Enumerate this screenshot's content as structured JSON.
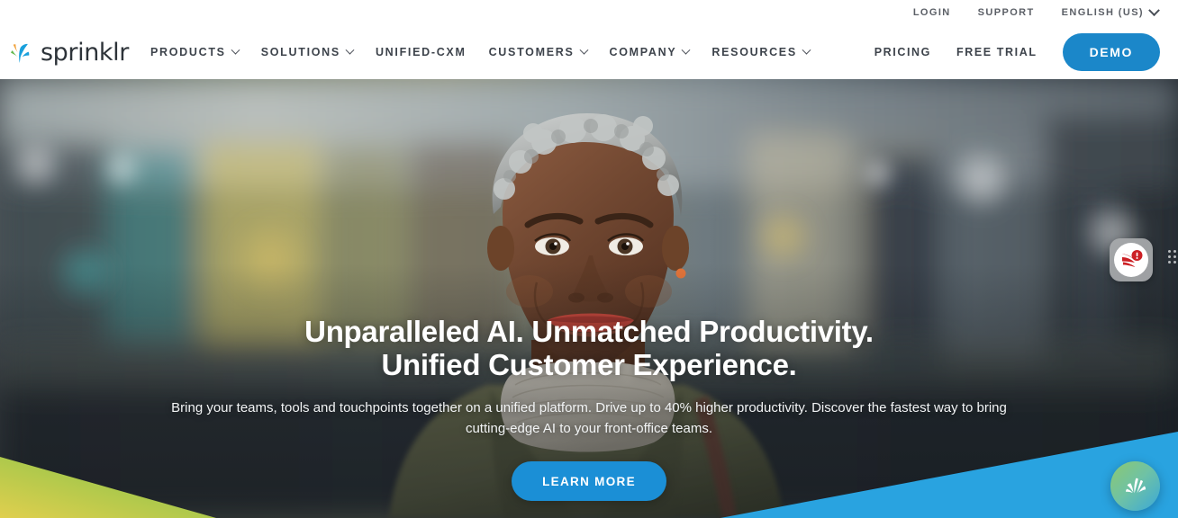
{
  "brand": {
    "name": "sprinklr",
    "logo_icon": "sprinklr-splash-logo"
  },
  "utility": {
    "login": "LOGIN",
    "support": "SUPPORT",
    "language": "ENGLISH (US)",
    "language_chevron_icon": "chevron-down-icon"
  },
  "nav": {
    "items": [
      {
        "label": "PRODUCTS",
        "has_dropdown": true
      },
      {
        "label": "SOLUTIONS",
        "has_dropdown": true
      },
      {
        "label": "UNIFIED-CXM",
        "has_dropdown": false
      },
      {
        "label": "CUSTOMERS",
        "has_dropdown": true
      },
      {
        "label": "COMPANY",
        "has_dropdown": true
      },
      {
        "label": "RESOURCES",
        "has_dropdown": true
      }
    ],
    "pricing": "PRICING",
    "free_trial": "FREE TRIAL",
    "demo": "DEMO"
  },
  "hero": {
    "title_line1": "Unparalleled AI. Unmatched Productivity.",
    "title_line2": "Unified Customer Experience.",
    "subtitle": "Bring your teams, tools and touchpoints together on a unified platform. Drive up to 40% higher productivity. Discover the fastest way to bring cutting-edge AI to your front-office teams.",
    "cta": "LEARN MORE"
  },
  "widgets": {
    "alert_icon": "red-alert-notification-icon",
    "drag_handle_icon": "drag-dots-icon",
    "chat_icon": "sprinklr-splash-chat-icon"
  },
  "colors": {
    "accent_blue": "#1b87c9",
    "cta_blue": "#1b8fd6",
    "nav_text": "#3d434b",
    "utility_text": "#5b5f66",
    "logo_orange": "#f0a23c",
    "logo_green": "#63b84b",
    "logo_blue": "#19a0dc",
    "alert_red": "#cc1f24",
    "wedge_yellow": "#ddd04f",
    "wedge_green": "#7dc242",
    "wedge_blue": "#29a3e0"
  }
}
